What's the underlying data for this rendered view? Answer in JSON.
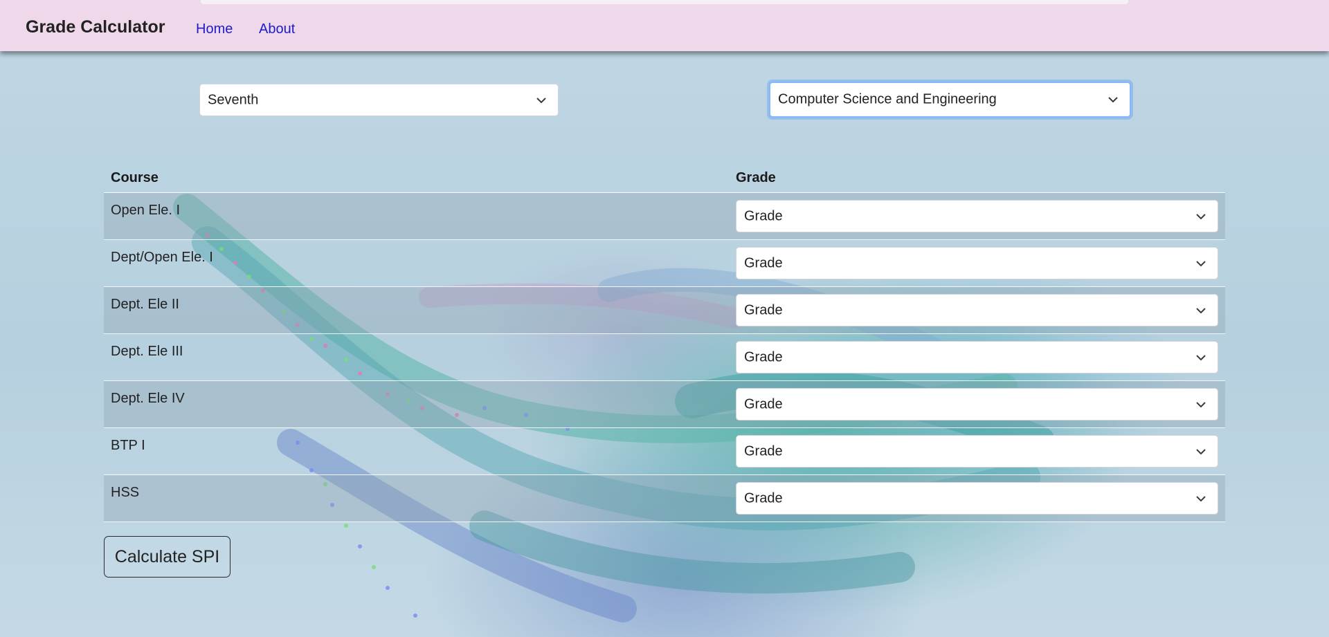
{
  "navbar": {
    "brand": "Grade Calculator",
    "links": [
      "Home",
      "About"
    ]
  },
  "filters": {
    "semester": "Seventh",
    "branch": "Computer Science and Engineering"
  },
  "table": {
    "headers": {
      "course": "Course",
      "grade": "Grade"
    },
    "rows": [
      {
        "course": "Open Ele. I",
        "grade": "Grade"
      },
      {
        "course": "Dept/Open Ele. I",
        "grade": "Grade"
      },
      {
        "course": "Dept. Ele II",
        "grade": "Grade"
      },
      {
        "course": "Dept. Ele III",
        "grade": "Grade"
      },
      {
        "course": "Dept. Ele IV",
        "grade": "Grade"
      },
      {
        "course": "BTP I",
        "grade": "Grade"
      },
      {
        "course": "HSS",
        "grade": "Grade"
      }
    ]
  },
  "actions": {
    "calculate_label": "Calculate SPI"
  },
  "colors": {
    "navbar_bg": "#efd8ea",
    "link": "#1c1cc8",
    "focus_ring": "#86b7fe"
  }
}
